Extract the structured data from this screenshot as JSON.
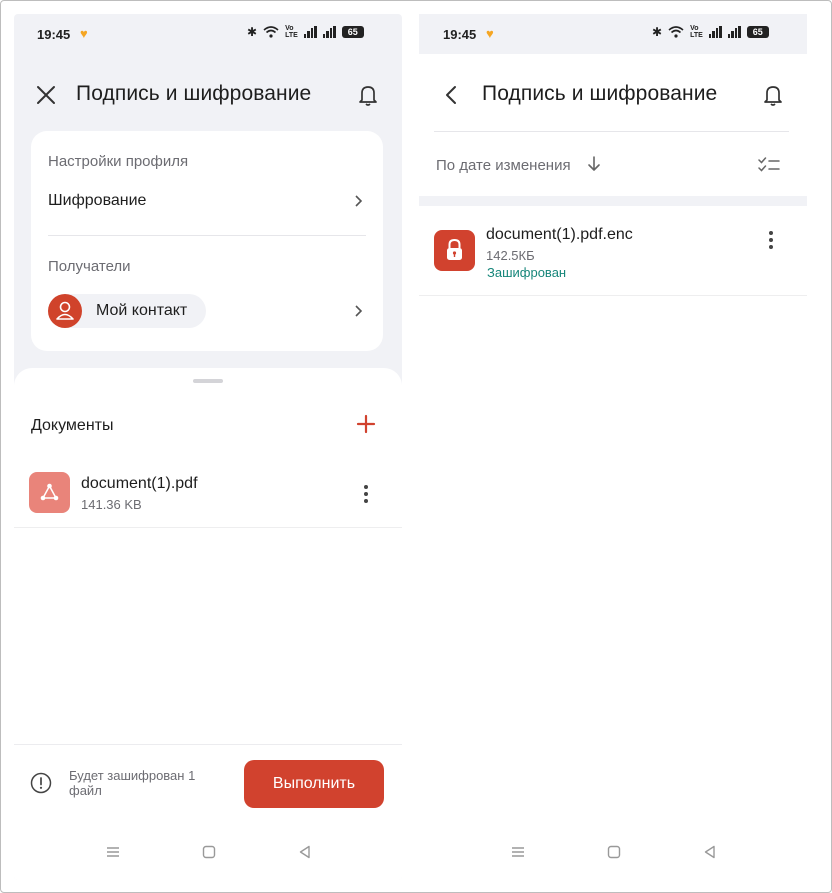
{
  "left_screen": {
    "status": {
      "time": "19:45",
      "battery": "65"
    },
    "header": {
      "title": "Подпись и шифрование"
    },
    "profile": {
      "settings_label": "Настройки профиля",
      "encryption_label": "Шифрование",
      "recipients_label": "Получатели",
      "contact_name": "Мой контакт"
    },
    "documents": {
      "title": "Документы",
      "items": [
        {
          "name": "document(1).pdf",
          "size": "141.36 KB"
        }
      ]
    },
    "footer": {
      "info_text": "Будет зашифрован 1 файл",
      "run_button": "Выполнить"
    }
  },
  "right_screen": {
    "status": {
      "time": "19:45",
      "battery": "65"
    },
    "header": {
      "title": "Подпись и шифрование"
    },
    "sort": {
      "label": "По дате изменения"
    },
    "files": [
      {
        "name": "document(1).pdf.enc",
        "size": "142.5КБ",
        "status": "Зашифрован"
      }
    ]
  },
  "colors": {
    "accent": "#d1422e",
    "doc_icon": "#e9847a",
    "encrypted_status": "#16867a",
    "background": "#f1f2f6"
  },
  "icons": {
    "close": "close-icon",
    "back": "back-arrow-icon",
    "bell": "bell-icon",
    "chevron": "chevron-right-icon",
    "person": "person-icon",
    "plus": "plus-icon",
    "pdf": "pdf-icon",
    "lock": "lock-icon",
    "more": "more-vertical-icon",
    "info": "info-icon",
    "sort_arrow": "arrow-down-icon",
    "select": "checklist-icon"
  }
}
